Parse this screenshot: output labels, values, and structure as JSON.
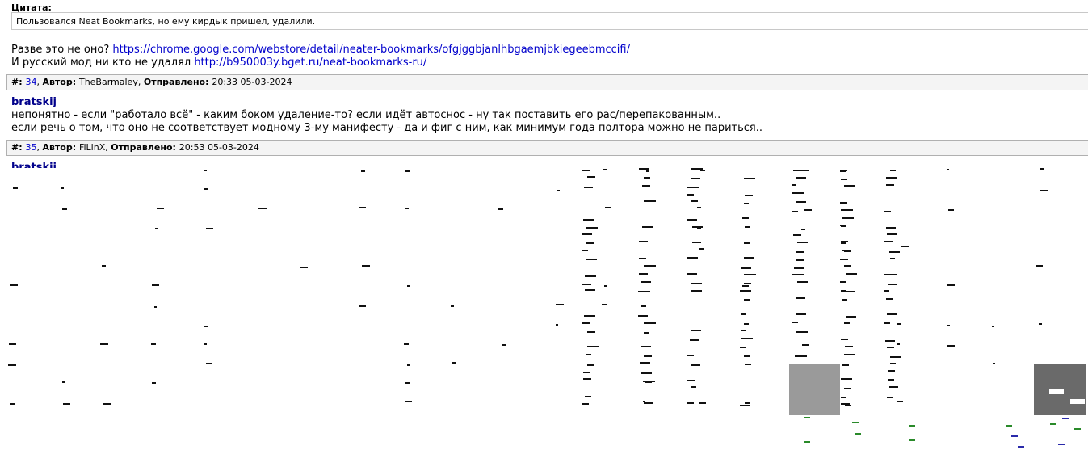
{
  "post_top": {
    "quote_label": "Цитата:",
    "quote_text": "Пользовался Neat Bookmarks, но ему кирдык пришел, удалили.",
    "line1_prefix": "Разве это не оно? ",
    "line1_link": "https://chrome.google.com/webstore/detail/neater-bookmarks/ofgjggbjanlhbgaemjbkiegeebmccifi/",
    "line2_prefix": "И русский мод ни кто не удалял ",
    "line2_link": "http://b950003y.bget.ru/neat-bookmarks-ru/"
  },
  "sep_34": {
    "num_label": "#: ",
    "num": "34",
    "author_label": "Автор: ",
    "author": "TheBarmaley",
    "sent_label": "Отправлено: ",
    "sent": "20:33 05-03-2024"
  },
  "post_35": {
    "author": "bratskij",
    "line1": "непонятно - если \"работало всё\" - каким боком удаление-то? если идёт автоснос - ну так поставить его рас/перепакованным..",
    "line2": "если речь о том, что оно не соответствует модному 3-му манифесту - да и фиг с ним, как минимум года полтора можно не париться.."
  },
  "sep_35": {
    "num_label": "#: ",
    "num": "35",
    "author_label": "Автор: ",
    "author": "FiLinX",
    "sent_label": "Отправлено: ",
    "sent": "20:53 05-03-2024"
  },
  "post_36": {
    "author": "bratskij"
  },
  "colors": {
    "author": "#00008b",
    "link": "#0000cc",
    "separator_bg": "#f4f4f4",
    "border": "#b0b0b0"
  }
}
